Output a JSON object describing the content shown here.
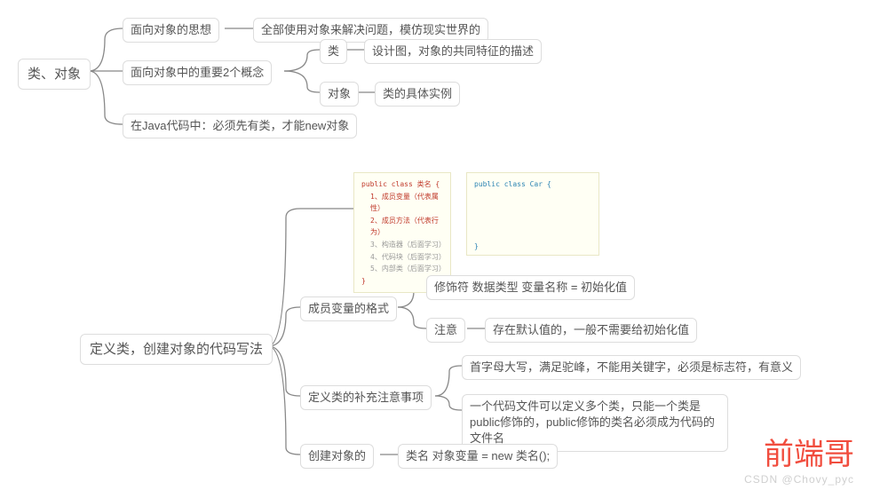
{
  "root1": {
    "label": "类、对象"
  },
  "root2": {
    "label": "定义类，创建对象的代码写法"
  },
  "n1": {
    "label": "面向对象的思想"
  },
  "n1a": {
    "label": "全部使用对象来解决问题，模仿现实世界的"
  },
  "n2": {
    "label": "面向对象中的重要2个概念"
  },
  "n2a": {
    "label": "类"
  },
  "n2a1": {
    "label": "设计图，对象的共同特征的描述"
  },
  "n2b": {
    "label": "对象"
  },
  "n2b1": {
    "label": "类的具体实例"
  },
  "n3": {
    "label": "在Java代码中：必须先有类，才能new对象"
  },
  "code1": {
    "l1": "public class 类名 {",
    "l2": "1、成员变量（代表属性）",
    "l3": "2、成员方法（代表行为）",
    "l4": "3、构造器（后面学习）",
    "l5": "4、代码块（后面学习）",
    "l6": "5、内部类（后面学习）",
    "l7": "}"
  },
  "code2": {
    "l1": "public class Car {",
    "l2": "}"
  },
  "m1": {
    "label": "成员变量的格式"
  },
  "m1a": {
    "label": "修饰符  数据类型 变量名称 = 初始化值"
  },
  "m1b": {
    "label": "注意"
  },
  "m1b1": {
    "label": "存在默认值的，一般不需要给初始化值"
  },
  "m2": {
    "label": "定义类的补充注意事项"
  },
  "m2a": {
    "label": "首字母大写，满足驼峰，不能用关键字，必须是标志符，有意义"
  },
  "m2b": {
    "label": "一个代码文件可以定义多个类，只能一个类是public修饰的，public修饰的类名必须成为代码的文件名"
  },
  "m3": {
    "label": "创建对象的"
  },
  "m3a": {
    "label": "类名 对象变量 = new 类名();"
  },
  "watermark": {
    "red": "前端哥",
    "grey": "CSDN @Chovy_pyc"
  }
}
